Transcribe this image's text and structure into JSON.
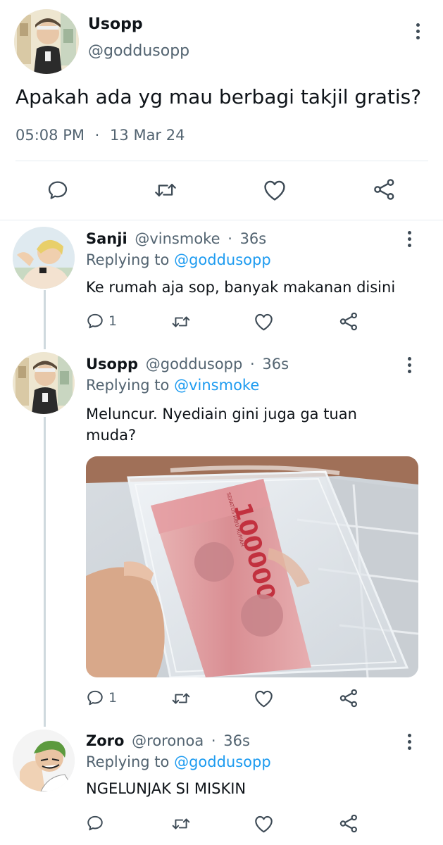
{
  "main_tweet": {
    "display_name": "Usopp",
    "handle": "@goddusopp",
    "text": "Apakah ada yg mau berbagi takjil gratis?",
    "time": "05:08 PM",
    "separator": "·",
    "date": "13 Mar 24"
  },
  "replies": [
    {
      "display_name": "Sanji",
      "handle": "@vinsmoke",
      "separator": "·",
      "time": "36s",
      "replying_prefix": "Replying to",
      "replying_handle": "@goddusopp",
      "text": "Ke rumah aja sop, banyak makanan disini",
      "reply_count": "1"
    },
    {
      "display_name": "Usopp",
      "handle": "@goddusopp",
      "separator": "·",
      "time": "36s",
      "replying_prefix": "Replying to",
      "replying_handle": "@vinsmoke",
      "text_line1": "Meluncur. Nyediain gini juga ga tuan",
      "text_line2": "muda?",
      "reply_count": "1",
      "banknote_text": "100000",
      "banknote_small": "SERATUS RIBU RUPIAH"
    },
    {
      "display_name": "Zoro",
      "handle": "@roronoa",
      "separator": "·",
      "time": "36s",
      "replying_prefix": "Replying to",
      "replying_handle": "@goddusopp",
      "text": "NGELUNJAK SI MISKIN"
    }
  ],
  "icons": [
    "reply-icon",
    "retweet-icon",
    "like-icon",
    "share-icon",
    "more-icon"
  ],
  "colors": {
    "link": "#1d9bf0",
    "muted": "#536471",
    "text": "#0f1419",
    "divider": "#e6ecf0"
  }
}
